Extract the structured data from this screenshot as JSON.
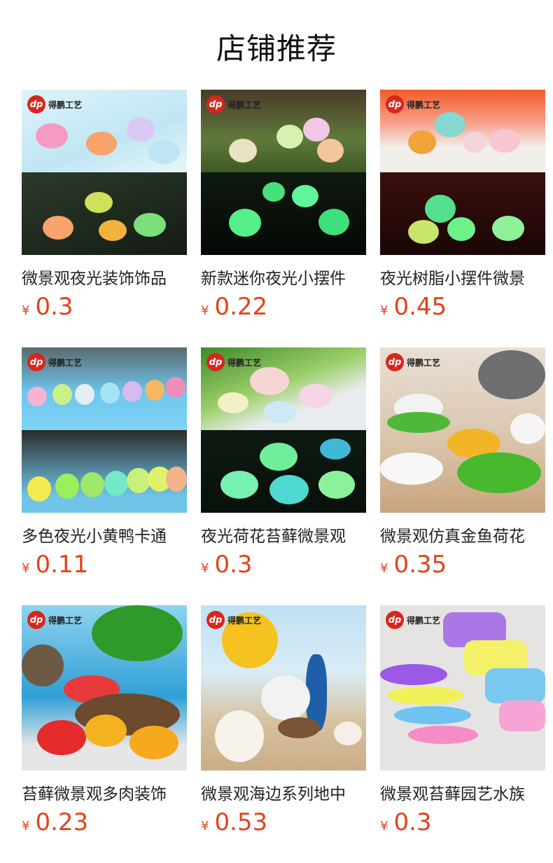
{
  "page": {
    "title": "店铺推荐"
  },
  "brand": {
    "logo_mark": "dp",
    "logo_text": "得鹏工艺"
  },
  "currency_symbol": "¥",
  "products": [
    {
      "name": "微景观夜光装饰饰品",
      "price": "0.3"
    },
    {
      "name": "新款迷你夜光小摆件",
      "price": "0.22"
    },
    {
      "name": "夜光树脂小摆件微景",
      "price": "0.45"
    },
    {
      "name": "多色夜光小黄鸭卡通",
      "price": "0.11"
    },
    {
      "name": "夜光荷花苔藓微景观",
      "price": "0.3"
    },
    {
      "name": "微景观仿真金鱼荷花",
      "price": "0.35"
    },
    {
      "name": "苔藓微景观多肉装饰",
      "price": "0.23"
    },
    {
      "name": "微景观海边系列地中",
      "price": "0.53"
    },
    {
      "name": "微景观苔藓园艺水族",
      "price": "0.3"
    }
  ],
  "colors": {
    "price": "#e2431b",
    "title": "#111111",
    "logo_red": "#d9261c"
  }
}
